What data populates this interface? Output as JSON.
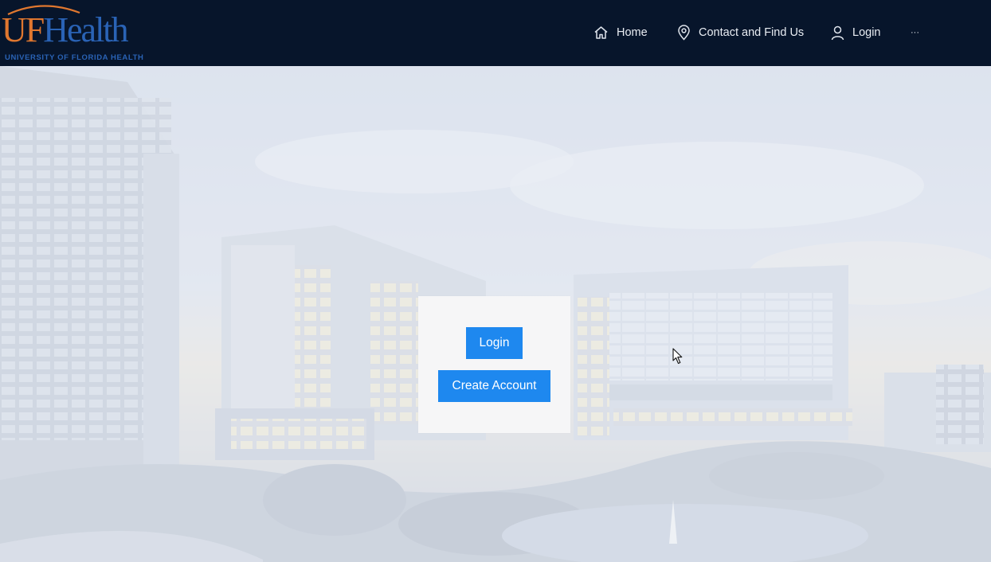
{
  "header": {
    "logo": {
      "uf": "UF",
      "health": "Health",
      "subtitle": "UNIVERSITY OF FLORIDA HEALTH"
    },
    "nav": [
      {
        "label": "Home",
        "icon": "home-icon"
      },
      {
        "label": "Contact and Find Us",
        "icon": "map-pin-icon"
      },
      {
        "label": "Login",
        "icon": "user-icon"
      },
      {
        "label": "···",
        "icon": "more-icon"
      }
    ]
  },
  "card": {
    "login_label": "Login",
    "create_account_label": "Create Account"
  },
  "colors": {
    "header_bg": "#07152b",
    "uf_orange": "#e0772f",
    "uf_blue": "#2a63b6",
    "button_blue": "#1e88ef",
    "card_bg": "#f6f6f7"
  }
}
